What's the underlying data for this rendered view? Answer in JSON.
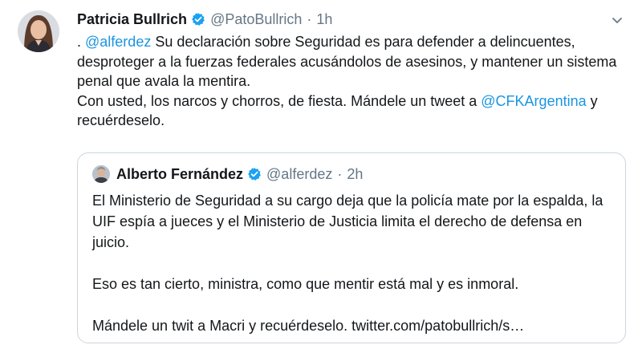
{
  "tweet": {
    "author_name": "Patricia Bullrich",
    "handle": "@PatoBullrich",
    "separator": "·",
    "time": "1h",
    "text_prefix": ". ",
    "mention_1": "@alferdez",
    "text_middle": " Su declaración sobre Seguridad es para defender a delincuentes, desproteger a la fuerzas federales acusándolos de asesinos, y mantener un sistema penal que avala la mentira.",
    "text_line_2": "Con usted, los narcos y chorros, de fiesta. Mándele un tweet a ",
    "mention_2": "@CFKArgentina",
    "text_suffix": " y recuérdeselo."
  },
  "quoted_tweet": {
    "author_name": "Alberto Fernández",
    "handle": "@alferdez",
    "separator": "·",
    "time": "2h",
    "paragraphs": [
      "El Ministerio de Seguridad a su cargo deja que la policía mate por la espalda, la UIF espía a jueces y el Ministerio de Justicia limita el derecho de defensa en juicio.",
      "Eso es tan cierto, ministra, como que mentir está mal y es inmoral.",
      "Mándele un twit a Macri y recuérdeselo. twitter.com/patobullrich/s…"
    ]
  },
  "icons": {
    "verified": "verified-badge-icon",
    "menu": "chevron-down-icon"
  },
  "colors": {
    "link": "#1b95e0",
    "secondary_text": "#657786",
    "verified": "#1da1f2",
    "border": "#ccd6dd"
  }
}
